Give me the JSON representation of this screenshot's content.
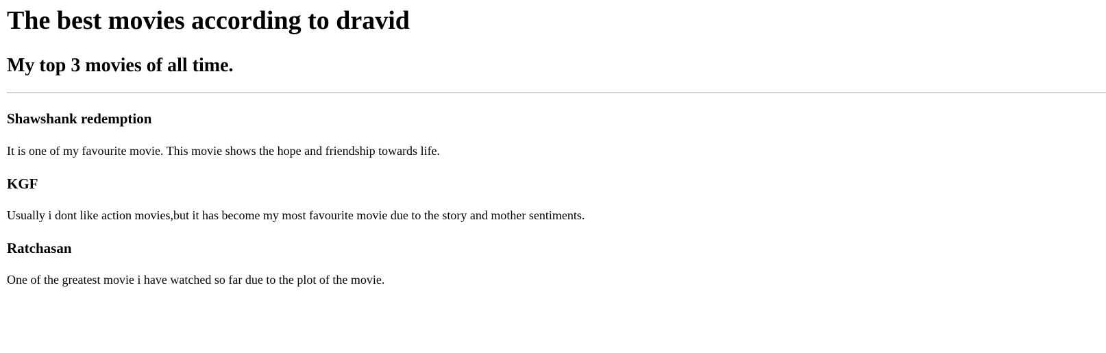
{
  "page": {
    "title": "The best movies according to dravid",
    "subtitle": "My top 3 movies of all time."
  },
  "movies": [
    {
      "name": "Shawshank redemption",
      "description": "It is one of my favourite movie. This movie shows the hope and friendship towards life."
    },
    {
      "name": "KGF",
      "description": "Usually i dont like action movies,but it has become my most favourite movie due to the story and mother sentiments."
    },
    {
      "name": "Ratchasan",
      "description": "One of the greatest movie i have watched so far due to the plot of the movie."
    }
  ]
}
